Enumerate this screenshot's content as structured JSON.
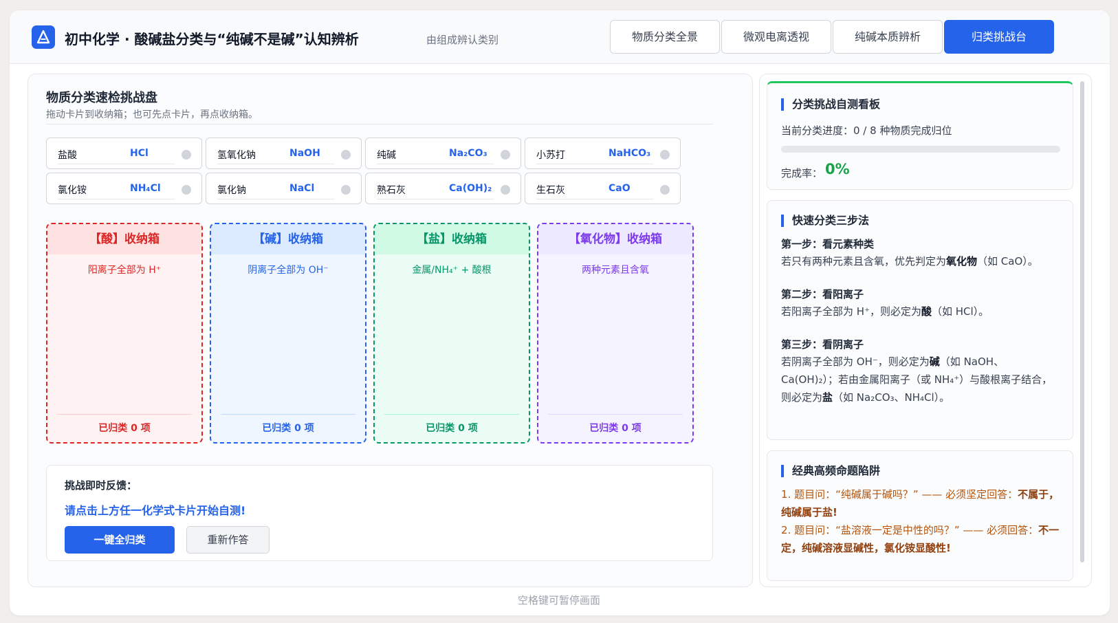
{
  "header": {
    "title": "初中化学 · 酸碱盐分类与“纯碱不是碱”认知辨析",
    "subtitle": "由组成辨认类别",
    "logo_icon": "triangle-flask-icon",
    "tabs": [
      {
        "label": "物质分类全景",
        "active": false
      },
      {
        "label": "微观电离透视",
        "active": false
      },
      {
        "label": "纯碱本质辨析",
        "active": false
      },
      {
        "label": "归类挑战台",
        "active": true
      }
    ]
  },
  "challenge": {
    "title": "物质分类速检挑战盘",
    "hint": "拖动卡片到收纳箱；也可先点卡片，再点收纳箱。",
    "cards": [
      {
        "name": "盐酸",
        "formula": "HCl"
      },
      {
        "name": "氢氧化钠",
        "formula": "NaOH"
      },
      {
        "name": "纯碱",
        "formula": "Na₂CO₃"
      },
      {
        "name": "小苏打",
        "formula": "NaHCO₃"
      },
      {
        "name": "氯化铵",
        "formula": "NH₄Cl"
      },
      {
        "name": "氯化钠",
        "formula": "NaCl"
      },
      {
        "name": "熟石灰",
        "formula": "Ca(OH)₂"
      },
      {
        "name": "生石灰",
        "formula": "CaO"
      }
    ],
    "bins": [
      {
        "label": "【酸】收纳箱",
        "rule": "阳离子全部为 H⁺",
        "count": "已归类 0 项",
        "color": "#dc2626",
        "bg": "#fef2f2",
        "head_bg": "#fee2e2",
        "sep": "#fecaca"
      },
      {
        "label": "【碱】收纳箱",
        "rule": "阴离子全部为 OH⁻",
        "count": "已归类 0 项",
        "color": "#2563eb",
        "bg": "#eff6ff",
        "head_bg": "#dbeafe",
        "sep": "#bfdbfe"
      },
      {
        "label": "【盐】收纳箱",
        "rule": "金属/NH₄⁺ + 酸根",
        "count": "已归类 0 项",
        "color": "#059669",
        "bg": "#ecfdf5",
        "head_bg": "#d1fae5",
        "sep": "#a7f3d0"
      },
      {
        "label": "【氧化物】收纳箱",
        "rule": "两种元素且含氧",
        "count": "已归类 0 项",
        "color": "#7c3aed",
        "bg": "#f5f3ff",
        "head_bg": "#ede9fe",
        "sep": "#ddd6fe"
      }
    ],
    "feedback": {
      "title": "挑战即时反馈：",
      "message": "请点击上方任一化学式卡片开始自测!",
      "primary_button": "一键全归类",
      "secondary_button": "重新作答"
    }
  },
  "sidebar": {
    "progress_card": {
      "title": "分类挑战自测看板",
      "progress_text": "当前分类进度：0 / 8 种物质完成归位",
      "progress_fraction": 0,
      "rate_label": "完成率：",
      "rate_value": "0%"
    },
    "steps_card": {
      "title": "快速分类三步法",
      "step1_head": "第一步：看元素种类",
      "step1_body_a": "若只有两种元素且含氧，优先判定为",
      "step1_bold": "氧化物",
      "step1_body_b": "（如 CaO）。",
      "step2_head": "第二步：看阳离子",
      "step2_body_a": "若阳离子全部为 H⁺，则必定为",
      "step2_bold": "酸",
      "step2_body_b": "（如 HCl）。",
      "step3_head": "第三步：看阴离子",
      "step3_body_a": "若阴离子全部为 OH⁻，则必定为",
      "step3_bold1": "碱",
      "step3_body_b": "（如 NaOH、Ca(OH)₂）；若由金属阳离子（或 NH₄⁺）与酸根离子结合，则必定为",
      "step3_bold2": "盐",
      "step3_body_c": "（如 Na₂CO₃、NH₄Cl）。"
    },
    "traps_card": {
      "title": "经典高频命题陷阱",
      "trap1_q": "1. 题目问：“纯碱属于碱吗？” —— 必须坚定回答：",
      "trap1_a": "不属于，纯碱属于盐!",
      "trap2_q": "2. 题目问：“盐溶液一定是中性的吗？” —— 必须回答：",
      "trap2_a": "不一定，纯碱溶液显碱性，氯化铵显酸性!"
    }
  },
  "footer": {
    "hint": "空格键可暂停画面"
  }
}
